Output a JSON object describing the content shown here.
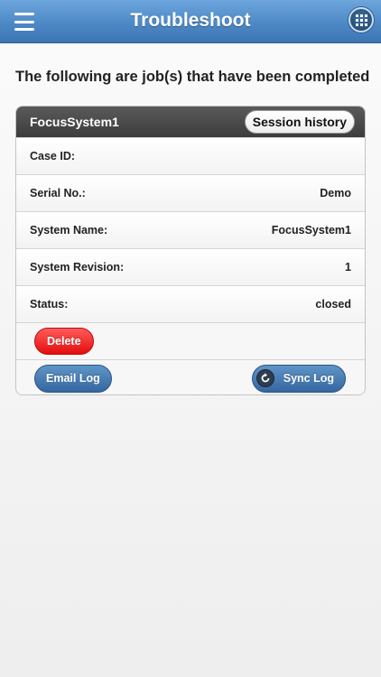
{
  "header": {
    "title": "Troubleshoot",
    "menu_icon": "hamburger-menu-icon",
    "apps_icon": "grid-apps-icon"
  },
  "intro": "The following are job(s) that have been completed",
  "job": {
    "title": "FocusSystem1",
    "session_history_label": "Session history",
    "fields": [
      {
        "label": "Case ID:",
        "value": ""
      },
      {
        "label": "Serial No.:",
        "value": "Demo"
      },
      {
        "label": "System Name:",
        "value": "FocusSystem1"
      },
      {
        "label": "System Revision:",
        "value": "1"
      },
      {
        "label": "Status:",
        "value": "closed"
      }
    ],
    "delete_label": "Delete",
    "email_log_label": "Email Log",
    "sync_log_label": "Sync Log",
    "sync_icon": "refresh-icon"
  },
  "colors": {
    "header_blue": "#4d89c6",
    "delete_red": "#e40d0d",
    "button_blue": "#3566a0",
    "card_header": "#3c3c3c"
  }
}
